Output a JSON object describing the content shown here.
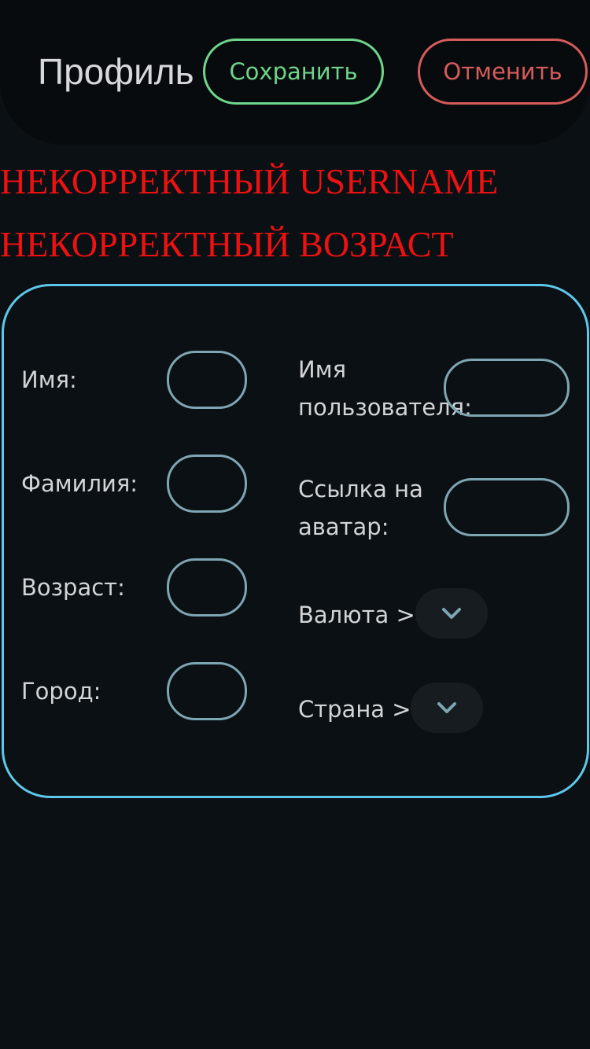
{
  "header": {
    "title": "Профиль",
    "save_label": "Сохранить",
    "cancel_label": "Отменить"
  },
  "errors": [
    "НЕКОРРЕКТНЫЙ USERNAME",
    "НЕКОРРЕКТНЫЙ ВОЗРАСТ"
  ],
  "form": {
    "first_name": {
      "label": "Имя:",
      "value": ""
    },
    "last_name": {
      "label": "Фамилия:",
      "value": ""
    },
    "age": {
      "label": "Возраст:",
      "value": ""
    },
    "city": {
      "label": "Город:",
      "value": ""
    },
    "username": {
      "label_line1": "Имя",
      "label_line2": "пользователя:",
      "value": ""
    },
    "avatar": {
      "label_line1": "Ссылка на",
      "label_line2": "аватар:",
      "value": ""
    },
    "currency": {
      "label": "Валюта >",
      "icon": "chevron-down-icon"
    },
    "country": {
      "label": "Страна >",
      "icon": "chevron-down-icon"
    }
  },
  "colors": {
    "background": "#0b1014",
    "header_bg": "#080b0e",
    "save_accent": "#6ed58b",
    "cancel_accent": "#d65b5b",
    "error": "#ee1111",
    "card_border": "#5ec8ea",
    "field_border": "#7ea5b3"
  }
}
